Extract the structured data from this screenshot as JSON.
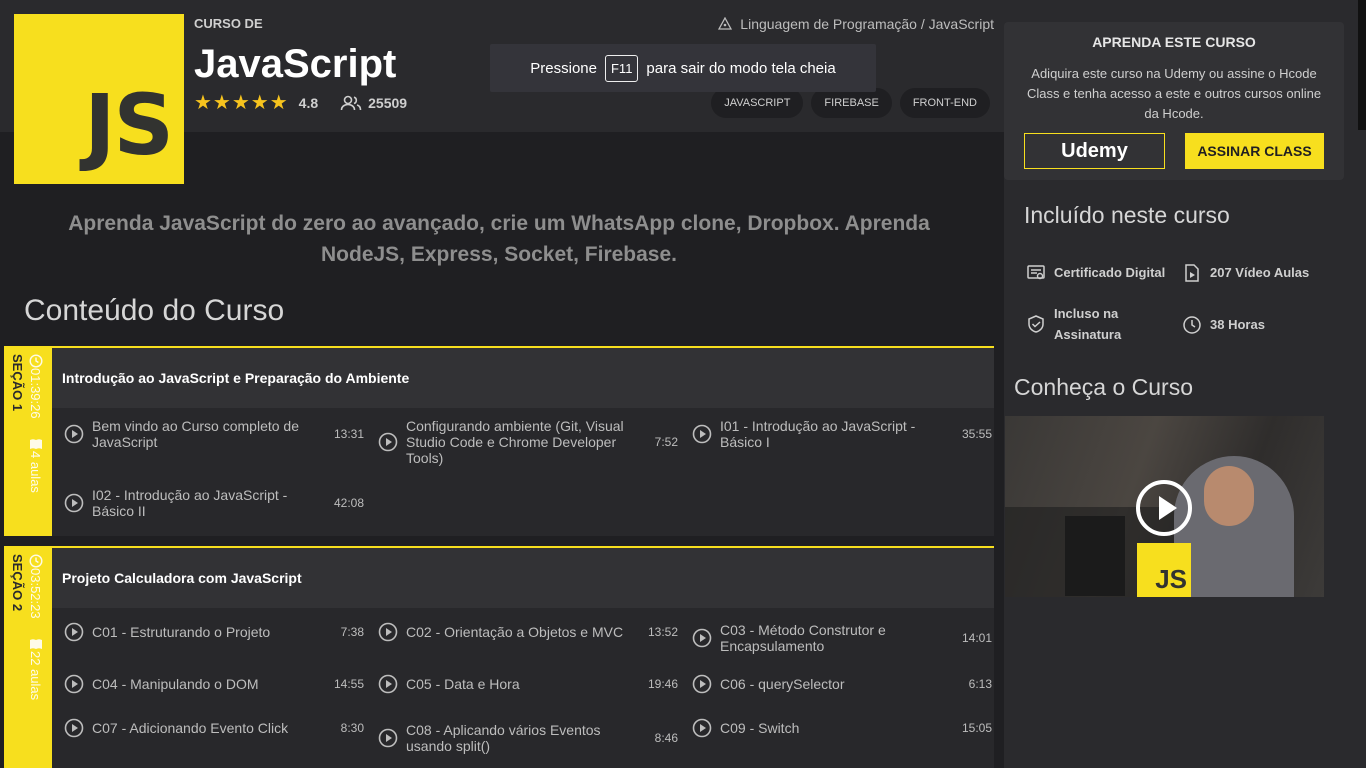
{
  "header": {
    "logo_text": "JS",
    "kicker": "CURSO DE",
    "title": "JavaScript",
    "stars": "★★★★★",
    "rating": "4.8",
    "students": "25509",
    "breadcrumb": "Linguagem de Programação / JavaScript",
    "tags": [
      "JAVASCRIPT",
      "FIREBASE",
      "FRONT-END"
    ]
  },
  "fullscreen_toast": {
    "before": "Pressione",
    "key": "F11",
    "after": "para sair do modo tela cheia"
  },
  "main": {
    "subtitle": "Aprenda JavaScript do zero ao avançado, crie um WhatsApp clone, Dropbox. Aprenda NodeJS, Express, Socket, Firebase.",
    "content_heading": "Conteúdo do Curso",
    "sections": [
      {
        "label": "SEÇÃO 1",
        "duration": "01:39:26",
        "lessons_count": "4 aulas",
        "title": "Introdução ao JavaScript e Preparação do Ambiente",
        "lessons": [
          {
            "title": "Bem vindo ao Curso completo de JavaScript",
            "duration": "13:31"
          },
          {
            "title": "Configurando ambiente (Git, Visual Studio Code e Chrome Developer Tools)",
            "duration": "7:52"
          },
          {
            "title": "I01 - Introdução ao JavaScript - Básico I",
            "duration": "35:55"
          },
          {
            "title": "I02 - Introdução ao JavaScript - Básico II",
            "duration": "42:08"
          }
        ]
      },
      {
        "label": "SEÇÃO 2",
        "duration": "03:52:23",
        "lessons_count": "22 aulas",
        "title": "Projeto Calculadora com JavaScript",
        "lessons": [
          {
            "title": "C01 - Estruturando o Projeto",
            "duration": "7:38"
          },
          {
            "title": "C02 - Orientação a Objetos e MVC",
            "duration": "13:52"
          },
          {
            "title": "C03 - Método Construtor e Encapsulamento",
            "duration": "14:01"
          },
          {
            "title": "C04 - Manipulando o DOM",
            "duration": "14:55"
          },
          {
            "title": "C05 - Data e Hora",
            "duration": "19:46"
          },
          {
            "title": "C06 - querySelector",
            "duration": "6:13"
          },
          {
            "title": "C07 - Adicionando Evento Click",
            "duration": "8:30"
          },
          {
            "title": "C08 - Aplicando vários Eventos usando split()",
            "duration": "8:46"
          },
          {
            "title": "C09 - Switch",
            "duration": "15:05"
          }
        ]
      }
    ]
  },
  "sidebar": {
    "cta_title": "APRENDA ESTE CURSO",
    "cta_text": "Adiquira este curso na Udemy ou assine o Hcode Class e tenha acesso a este e outros cursos online da Hcode.",
    "udemy_label": "Udemy",
    "assinar_label": "ASSINAR CLASS",
    "included_heading": "Incluído neste curso",
    "features": {
      "certificate": "Certificado Digital",
      "videos": "207 Vídeo Aulas",
      "subscription": "Incluso na Assinatura",
      "hours": "38 Horas"
    },
    "know_heading": "Conheça o Curso",
    "video_badge": "JS"
  },
  "colors": {
    "accent": "#f7df1e",
    "bg": "#1f1f22",
    "panel": "#2a2a2d"
  },
  "icons": [
    "graduation-cap-icon",
    "users-icon",
    "clock-icon",
    "book-icon",
    "play-circle-icon",
    "certificate-icon",
    "video-file-icon",
    "shield-check-icon"
  ]
}
